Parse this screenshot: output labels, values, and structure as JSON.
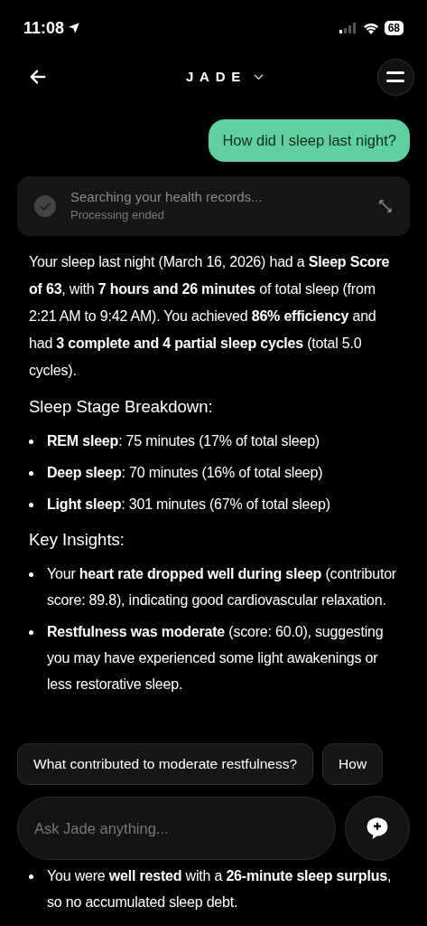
{
  "status_bar": {
    "time": "11:08",
    "battery": "68"
  },
  "header": {
    "title": "JADE"
  },
  "user_message": "How did I sleep last night?",
  "tool_status": {
    "title": "Searching your health records...",
    "subtitle": "Processing ended",
    "done": true
  },
  "answer": {
    "intro": "Your sleep last night (March 16, 2026) had a **Sleep Score of 63**, with **7 hours and 26 minutes** of total sleep (from 2:21 AM to 9:42 AM). You achieved **86% efficiency** and had **3 complete and 4 partial sleep cycles** (total 5.0 cycles).",
    "sections": [
      {
        "heading": "Sleep Stage Breakdown:",
        "bullets": [
          "**REM sleep**: 75 minutes (17% of total sleep)",
          "**Deep sleep**: 70 minutes (16% of total sleep)",
          "**Light sleep**: 301 minutes (67% of total sleep)"
        ]
      },
      {
        "heading": "Key Insights:",
        "bullets": [
          "Your **heart rate dropped well during sleep** (contributor score: 89.8), indicating good cardiovascular relaxation.",
          "**Restfulness was moderate** (score: 60.0), suggesting you may have experienced some light awakenings or less restorative sleep."
        ]
      }
    ]
  },
  "suggestions": [
    "What contributed to moderate restfulness?",
    "How"
  ],
  "input": {
    "placeholder": "Ask Jade anything..."
  },
  "trailing_bullet": "You were **well rested** with a **26-minute sleep surplus**, so no accumulated sleep debt."
}
